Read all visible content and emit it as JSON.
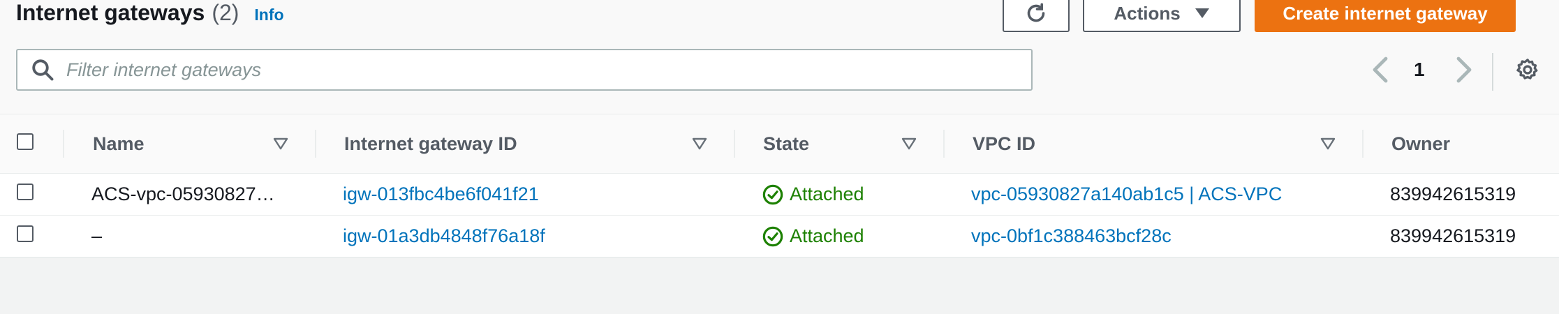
{
  "header": {
    "title": "Internet gateways",
    "count": "(2)",
    "info_label": "Info",
    "actions_label": "Actions",
    "create_label": "Create internet gateway",
    "refresh_icon": "refresh-icon",
    "brand_color": "#ec7211"
  },
  "search": {
    "placeholder": "Filter internet gateways",
    "value": ""
  },
  "pagination": {
    "current_page": "1"
  },
  "table": {
    "columns": [
      "Name",
      "Internet gateway ID",
      "State",
      "VPC ID",
      "Owner"
    ],
    "rows": [
      {
        "name": "ACS-vpc-05930827…",
        "gateway_id": "igw-013fbc4be6f041f21",
        "state": "Attached",
        "vpc_id": "vpc-05930827a140ab1c5 | ACS-VPC",
        "owner": "839942615319"
      },
      {
        "name": "–",
        "gateway_id": "igw-01a3db4848f76a18f",
        "state": "Attached",
        "vpc_id": "vpc-0bf1c388463bcf28c",
        "owner": "839942615319"
      }
    ]
  },
  "colors": {
    "link": "#0073bb",
    "success": "#1d8102",
    "text_secondary": "#545b64"
  }
}
